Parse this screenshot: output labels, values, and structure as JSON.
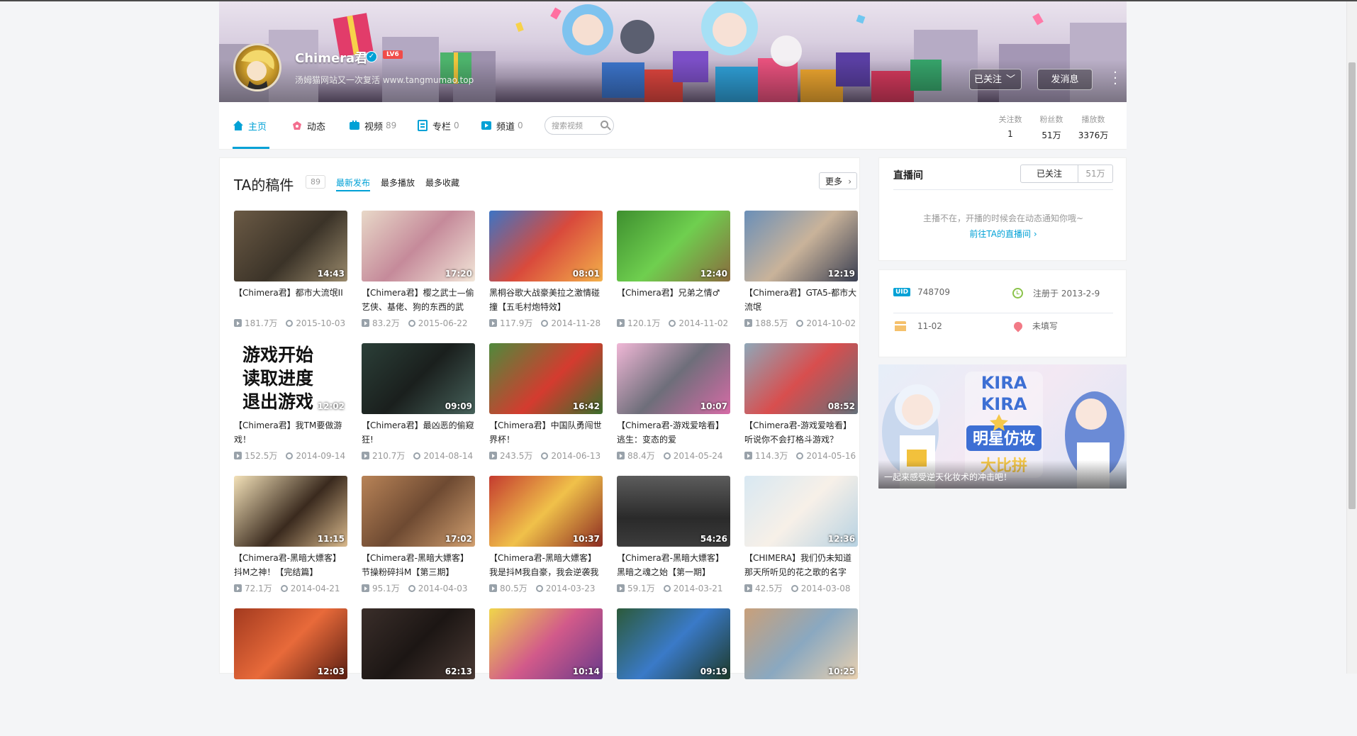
{
  "banner": {
    "username": "Chimera君",
    "level": "LV6",
    "sign": "汤姆猫网站又一次复活 www.tangmumao.top",
    "follow_btn": "已关注",
    "message_btn": "发消息"
  },
  "nav": {
    "items": [
      {
        "label": "主页",
        "count": "",
        "icon": "home-icon"
      },
      {
        "label": "动态",
        "count": "",
        "icon": "dynamic-icon"
      },
      {
        "label": "视频",
        "count": "89",
        "icon": "video-icon"
      },
      {
        "label": "专栏",
        "count": "0",
        "icon": "article-icon"
      },
      {
        "label": "频道",
        "count": "0",
        "icon": "channel-icon"
      }
    ],
    "search_placeholder": "搜索视频",
    "stats": [
      {
        "label": "关注数",
        "value": "1"
      },
      {
        "label": "粉丝数",
        "value": "51万"
      },
      {
        "label": "播放数",
        "value": "3376万"
      }
    ]
  },
  "submissions": {
    "title": "TA的稿件",
    "count": "89",
    "tabs": [
      "最新发布",
      "最多播放",
      "最多收藏"
    ],
    "more": "更多",
    "videos": [
      {
        "title": "【Chimera君】都市大流氓II",
        "duration": "14:43",
        "views": "181.7万",
        "date": "2015-10-03"
      },
      {
        "title": "【Chimera君】樱之武士—偷艺侠、基佬、狗的东西的武",
        "duration": "17:20",
        "views": "83.2万",
        "date": "2015-06-22"
      },
      {
        "title": "黑桐谷歌大战豪美拉之激情碰撞【五毛村炮特效】",
        "duration": "08:01",
        "views": "117.9万",
        "date": "2014-11-28"
      },
      {
        "title": "【Chimera君】兄弟之情♂",
        "duration": "12:40",
        "views": "120.1万",
        "date": "2014-11-02"
      },
      {
        "title": "【Chimera君】GTA5-都市大流氓",
        "duration": "12:19",
        "views": "188.5万",
        "date": "2014-10-02"
      },
      {
        "title": "【Chimera君】我TM要做游戏！",
        "duration": "12:02",
        "views": "152.5万",
        "date": "2014-09-14"
      },
      {
        "title": "【Chimera君】最凶恶的偷窥狂!",
        "duration": "09:09",
        "views": "210.7万",
        "date": "2014-08-14"
      },
      {
        "title": "【Chimera君】中国队勇闯世界杯！",
        "duration": "16:42",
        "views": "243.5万",
        "date": "2014-06-13"
      },
      {
        "title": "【Chimera君-游戏爱啥看】逃生：变态的爱",
        "duration": "10:07",
        "views": "88.4万",
        "date": "2014-05-24"
      },
      {
        "title": "【Chimera君-游戏爱啥看】听说你不会打格斗游戏？",
        "duration": "08:52",
        "views": "114.3万",
        "date": "2014-05-16"
      },
      {
        "title": "【Chimera君-黑暗大嫖客】抖M之神！【完结篇】",
        "duration": "11:15",
        "views": "72.1万",
        "date": "2014-04-21"
      },
      {
        "title": "【Chimera君-黑暗大嫖客】节操粉碎抖M【第三期】",
        "duration": "17:02",
        "views": "95.1万",
        "date": "2014-04-03"
      },
      {
        "title": "【Chimera君-黑暗大嫖客】我是抖M我自豪，我会逆袭我",
        "duration": "10:37",
        "views": "80.5万",
        "date": "2014-03-23"
      },
      {
        "title": "【Chimera君-黑暗大嫖客】黑暗之魂之始【第一期】",
        "duration": "54:26",
        "views": "59.1万",
        "date": "2014-03-21"
      },
      {
        "title": "【CHIMERA】我们仍未知道那天所听见的花之歌的名字",
        "duration": "12:36",
        "views": "42.5万",
        "date": "2014-03-08"
      },
      {
        "title": "",
        "duration": "12:03",
        "views": "",
        "date": ""
      },
      {
        "title": "",
        "duration": "62:13",
        "views": "",
        "date": ""
      },
      {
        "title": "",
        "duration": "10:14",
        "views": "",
        "date": ""
      },
      {
        "title": "",
        "duration": "09:19",
        "views": "",
        "date": ""
      },
      {
        "title": "",
        "duration": "10:25",
        "views": "",
        "date": ""
      }
    ],
    "thumb_text": "游戏开始\n读取进度\n退出游戏"
  },
  "live": {
    "title": "直播间",
    "followed": "已关注",
    "fans": "51万",
    "message": "主播不在，开播的时候会在动态通知你哦~",
    "link": "前往TA的直播间"
  },
  "info": {
    "uid_label": "UID",
    "uid": "748709",
    "registered": "注册于 2013-2-9",
    "birthday": "11-02",
    "location": "未填写"
  },
  "ad": {
    "caption": "一起来感受逆天化妆术的冲击吧！",
    "art_line1": "KIRA",
    "art_line2": "KIRA",
    "art_line3": "明星仿妆",
    "art_line4": "大比拼"
  },
  "colors": {
    "accent": "#00a1d6",
    "level_badge": "#f04c49",
    "page_bg": "#f4f5f7"
  }
}
